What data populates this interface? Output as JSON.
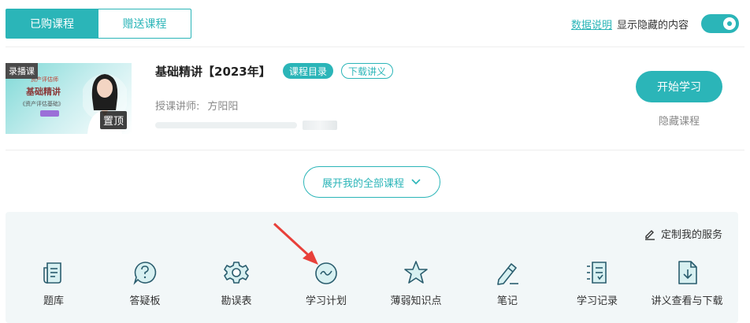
{
  "tabs": [
    {
      "label": "已购课程",
      "active": true
    },
    {
      "label": "赠送课程",
      "active": false
    }
  ],
  "top_right": {
    "data_link": "数据说明",
    "show_hidden_label": "显示隐藏的内容",
    "toggle_on": true
  },
  "course": {
    "thumb_tag": "录播课",
    "thumb_small": "资产评估师",
    "thumb_title": "基础精讲",
    "thumb_sub": "《资产评估基础》",
    "pin_label": "置顶",
    "title": "基础精讲【2023年】",
    "catalog_label": "课程目录",
    "download_label": "下载讲义",
    "teacher_label": "授课讲师:",
    "teacher_name": "方阳阳",
    "start_label": "开始学习",
    "hide_label": "隐藏课程"
  },
  "expand_label": "展开我的全部课程",
  "services": {
    "custom_label": "定制我的服务",
    "items": [
      {
        "label": "题库",
        "icon": "question-bank-icon"
      },
      {
        "label": "答疑板",
        "icon": "qa-board-icon"
      },
      {
        "label": "勘误表",
        "icon": "errata-gear-icon"
      },
      {
        "label": "学习计划",
        "icon": "study-plan-icon"
      },
      {
        "label": "薄弱知识点",
        "icon": "weak-points-star-icon"
      },
      {
        "label": "笔记",
        "icon": "notes-pen-icon"
      },
      {
        "label": "学习记录",
        "icon": "study-record-icon"
      },
      {
        "label": "讲义查看与下载",
        "icon": "handout-download-icon"
      }
    ]
  },
  "colors": {
    "accent": "#2bb5b8",
    "annotation_arrow": "#e8403a"
  }
}
